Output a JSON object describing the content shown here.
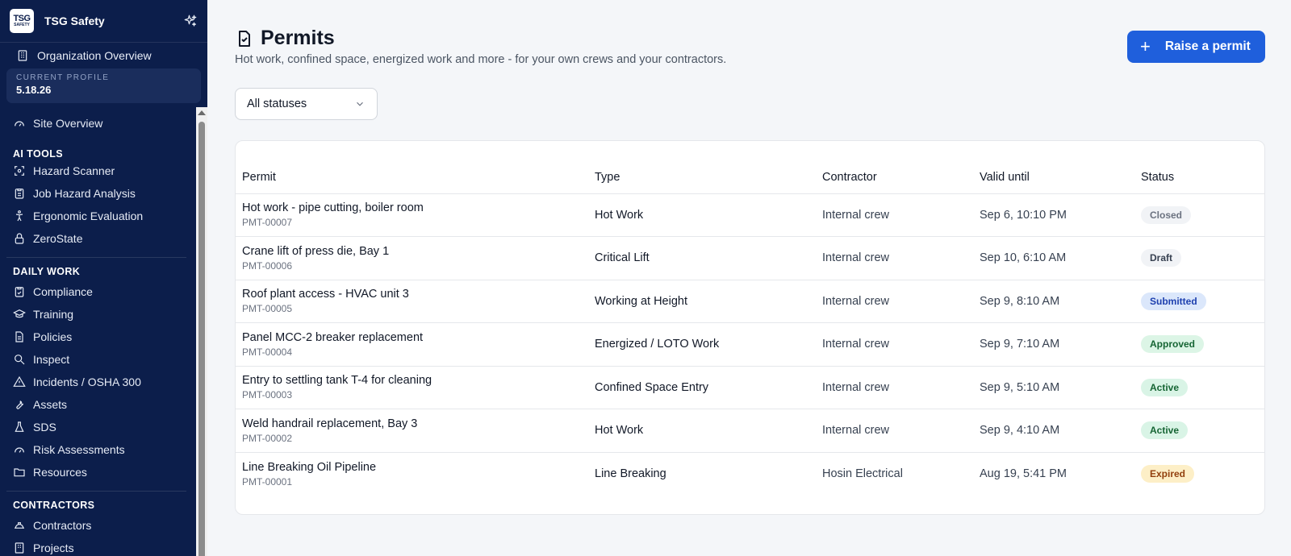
{
  "brand": {
    "name": "TSG Safety",
    "logo_top": "TSG",
    "logo_bottom": "SAFETY"
  },
  "org": {
    "label": "Organization Overview"
  },
  "profile": {
    "label": "CURRENT PROFILE",
    "value": "5.18.26"
  },
  "nav": {
    "site_overview": "Site Overview",
    "sections": [
      {
        "title": "AI TOOLS",
        "items": [
          "Hazard Scanner",
          "Job Hazard Analysis",
          "Ergonomic Evaluation",
          "ZeroState"
        ]
      },
      {
        "title": "DAILY WORK",
        "items": [
          "Compliance",
          "Training",
          "Policies",
          "Inspect",
          "Incidents / OSHA 300",
          "Assets",
          "SDS",
          "Risk Assessments",
          "Resources"
        ]
      },
      {
        "title": "CONTRACTORS",
        "items": [
          "Contractors",
          "Projects"
        ]
      }
    ]
  },
  "page": {
    "title": "Permits",
    "subtitle": "Hot work, confined space, energized work and more - for your own crews and your contractors.",
    "raise_button": "Raise a permit",
    "filter": {
      "selected": "All statuses"
    }
  },
  "table": {
    "headers": [
      "Permit",
      "Type",
      "Contractor",
      "Valid until",
      "Status"
    ],
    "rows": [
      {
        "name": "Hot work - pipe cutting, boiler room",
        "id": "PMT-00007",
        "type": "Hot Work",
        "contractor": "Internal crew",
        "valid": "Sep 6, 10:10 PM",
        "status": "Closed"
      },
      {
        "name": "Crane lift of press die, Bay 1",
        "id": "PMT-00006",
        "type": "Critical Lift",
        "contractor": "Internal crew",
        "valid": "Sep 10, 6:10 AM",
        "status": "Draft"
      },
      {
        "name": "Roof plant access - HVAC unit 3",
        "id": "PMT-00005",
        "type": "Working at Height",
        "contractor": "Internal crew",
        "valid": "Sep 9, 8:10 AM",
        "status": "Submitted"
      },
      {
        "name": "Panel MCC-2 breaker replacement",
        "id": "PMT-00004",
        "type": "Energized / LOTO Work",
        "contractor": "Internal crew",
        "valid": "Sep 9, 7:10 AM",
        "status": "Approved"
      },
      {
        "name": "Entry to settling tank T-4 for cleaning",
        "id": "PMT-00003",
        "type": "Confined Space Entry",
        "contractor": "Internal crew",
        "valid": "Sep 9, 5:10 AM",
        "status": "Active"
      },
      {
        "name": "Weld handrail replacement, Bay 3",
        "id": "PMT-00002",
        "type": "Hot Work",
        "contractor": "Internal crew",
        "valid": "Sep 9, 4:10 AM",
        "status": "Active"
      },
      {
        "name": "Line Breaking Oil Pipeline",
        "id": "PMT-00001",
        "type": "Line Breaking",
        "contractor": "Hosin Electrical",
        "valid": "Aug 19, 5:41 PM",
        "status": "Expired"
      }
    ]
  },
  "status_colors": {
    "Closed": {
      "bg": "#f1f3f6",
      "fg": "#6b7280"
    },
    "Draft": {
      "bg": "#f1f3f6",
      "fg": "#374151"
    },
    "Submitted": {
      "bg": "#dbe7fb",
      "fg": "#1e40af"
    },
    "Approved": {
      "bg": "#dcf5e6",
      "fg": "#166534"
    },
    "Active": {
      "bg": "#d9f4e6",
      "fg": "#166534"
    },
    "Expired": {
      "bg": "#fdefc7",
      "fg": "#92400e"
    }
  },
  "colors": {
    "sidebar_bg": "#0c1e4b",
    "accent": "#1f5fdc"
  }
}
